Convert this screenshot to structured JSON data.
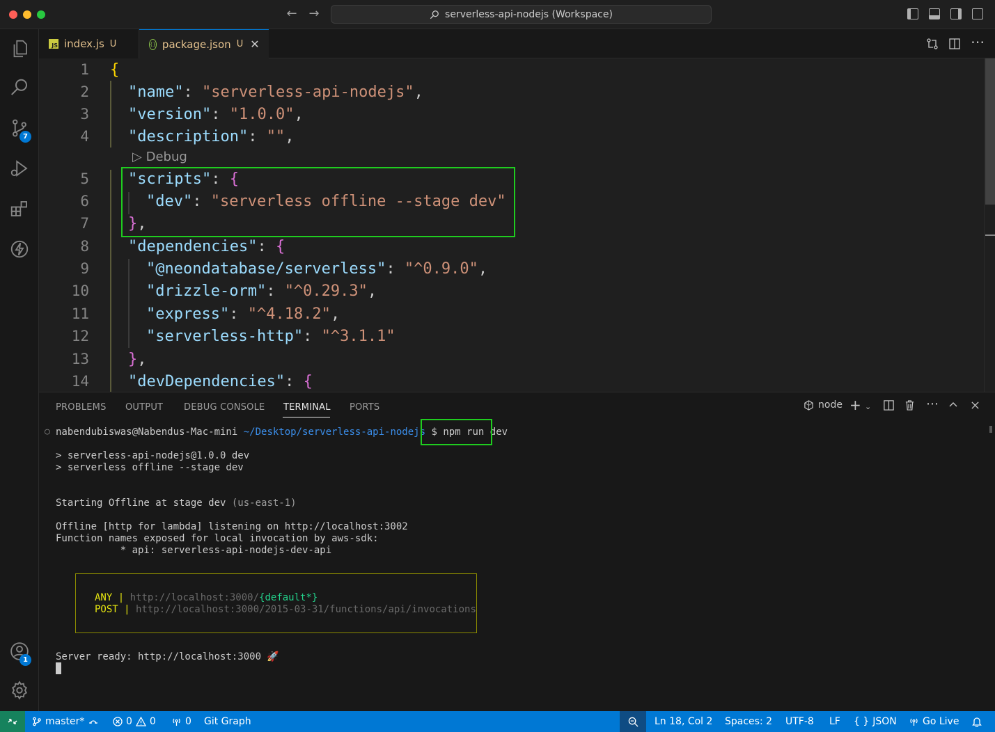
{
  "window": {
    "title": "serverless-api-nodejs (Workspace)"
  },
  "tabs": [
    {
      "label": "index.js",
      "status": "U",
      "icon": "js-file-icon"
    },
    {
      "label": "package.json",
      "status": "U",
      "icon": "json-file-icon",
      "close": "✕"
    }
  ],
  "activity_badges": {
    "source_control": "7",
    "accounts": "1"
  },
  "editor": {
    "codelens": "Debug",
    "line_numbers": [
      "1",
      "2",
      "3",
      "4",
      "5",
      "6",
      "7",
      "8",
      "9",
      "10",
      "11",
      "12",
      "13",
      "14"
    ],
    "package": {
      "name_key": "\"name\"",
      "name_value": "\"serverless-api-nodejs\"",
      "version_key": "\"version\"",
      "version_value": "\"1.0.0\"",
      "description_key": "\"description\"",
      "description_value": "\"\"",
      "scripts_key": "\"scripts\"",
      "dev_key": "\"dev\"",
      "dev_value": "\"serverless offline --stage dev\"",
      "dependencies_key": "\"dependencies\"",
      "deps": [
        {
          "key": "\"@neondatabase/serverless\"",
          "value": "\"^0.9.0\"",
          "comma": ","
        },
        {
          "key": "\"drizzle-orm\"",
          "value": "\"^0.29.3\"",
          "comma": ","
        },
        {
          "key": "\"express\"",
          "value": "\"^4.18.2\"",
          "comma": ","
        },
        {
          "key": "\"serverless-http\"",
          "value": "\"^3.1.1\"",
          "comma": ""
        }
      ],
      "devdeps_key": "\"devDependencies\""
    }
  },
  "panel": {
    "tabs": [
      "PROBLEMS",
      "OUTPUT",
      "DEBUG CONSOLE",
      "TERMINAL",
      "PORTS"
    ],
    "active_tab": "TERMINAL",
    "terminal_name": "node"
  },
  "terminal": {
    "prompt_user": "nabendubiswas@Nabendus-Mac-mini",
    "prompt_path": "~/Desktop/serverless-api-nodejs",
    "prompt_symbol": "$",
    "command": "npm run dev",
    "script_line1": "> serverless-api-nodejs@1.0.0 dev",
    "script_line2": "> serverless offline --stage dev",
    "starting": "Starting Offline at stage dev",
    "region": "(us-east-1)",
    "listening": "Offline [http for lambda] listening on http://localhost:3002",
    "functions_exposed": "Function names exposed for local invocation by aws-sdk:",
    "function_item": "           * api: serverless-api-nodejs-dev-api",
    "route_any_method": "ANY",
    "route_any_url": "http://localhost:3000/",
    "route_any_path": "{default*}",
    "route_post_method": "POST",
    "route_post_url": "http://localhost:3000/2015-03-31/functions/api/invocations",
    "route_sep": " | ",
    "ready": "Server ready: http://localhost:3000 🚀"
  },
  "statusbar": {
    "branch": "master*",
    "errors": "0",
    "warnings": "0",
    "ports": "0",
    "git_graph": "Git Graph",
    "position": "Ln 18, Col 2",
    "spaces": "Spaces: 2",
    "encoding": "UTF-8",
    "eol": "LF",
    "language": "JSON",
    "language_braces": "{ }",
    "golive": "Go Live"
  },
  "colors": {
    "highlight": "#1fcc1f",
    "accent": "#0078d4",
    "json_key": "#9cdcfe",
    "json_string": "#ce9178"
  }
}
